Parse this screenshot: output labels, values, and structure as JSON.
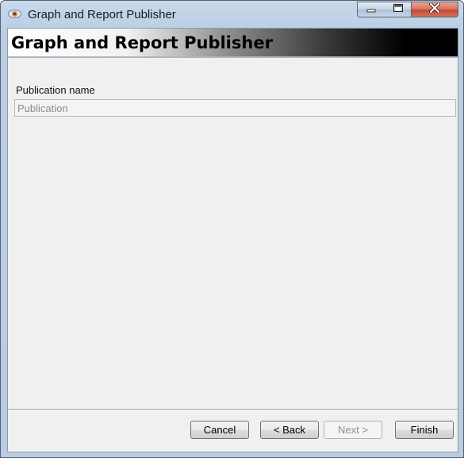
{
  "window": {
    "title": "Graph and Report Publisher",
    "icon": "app-eye-icon"
  },
  "caption_buttons": {
    "minimize_icon": "minimize-icon",
    "maximize_icon": "maximize-icon",
    "close_icon": "close-icon"
  },
  "banner": {
    "title": "Graph and Report Publisher"
  },
  "form": {
    "publication_label": "Publication name",
    "publication_placeholder": "Publication",
    "publication_value": ""
  },
  "buttons": {
    "cancel": "Cancel",
    "back": "< Back",
    "next": "Next >",
    "finish": "Finish",
    "next_enabled": false
  },
  "colors": {
    "dialog_bg": "#f0f0f0",
    "frame": "#b9cee4",
    "close_button": "#c24630"
  }
}
